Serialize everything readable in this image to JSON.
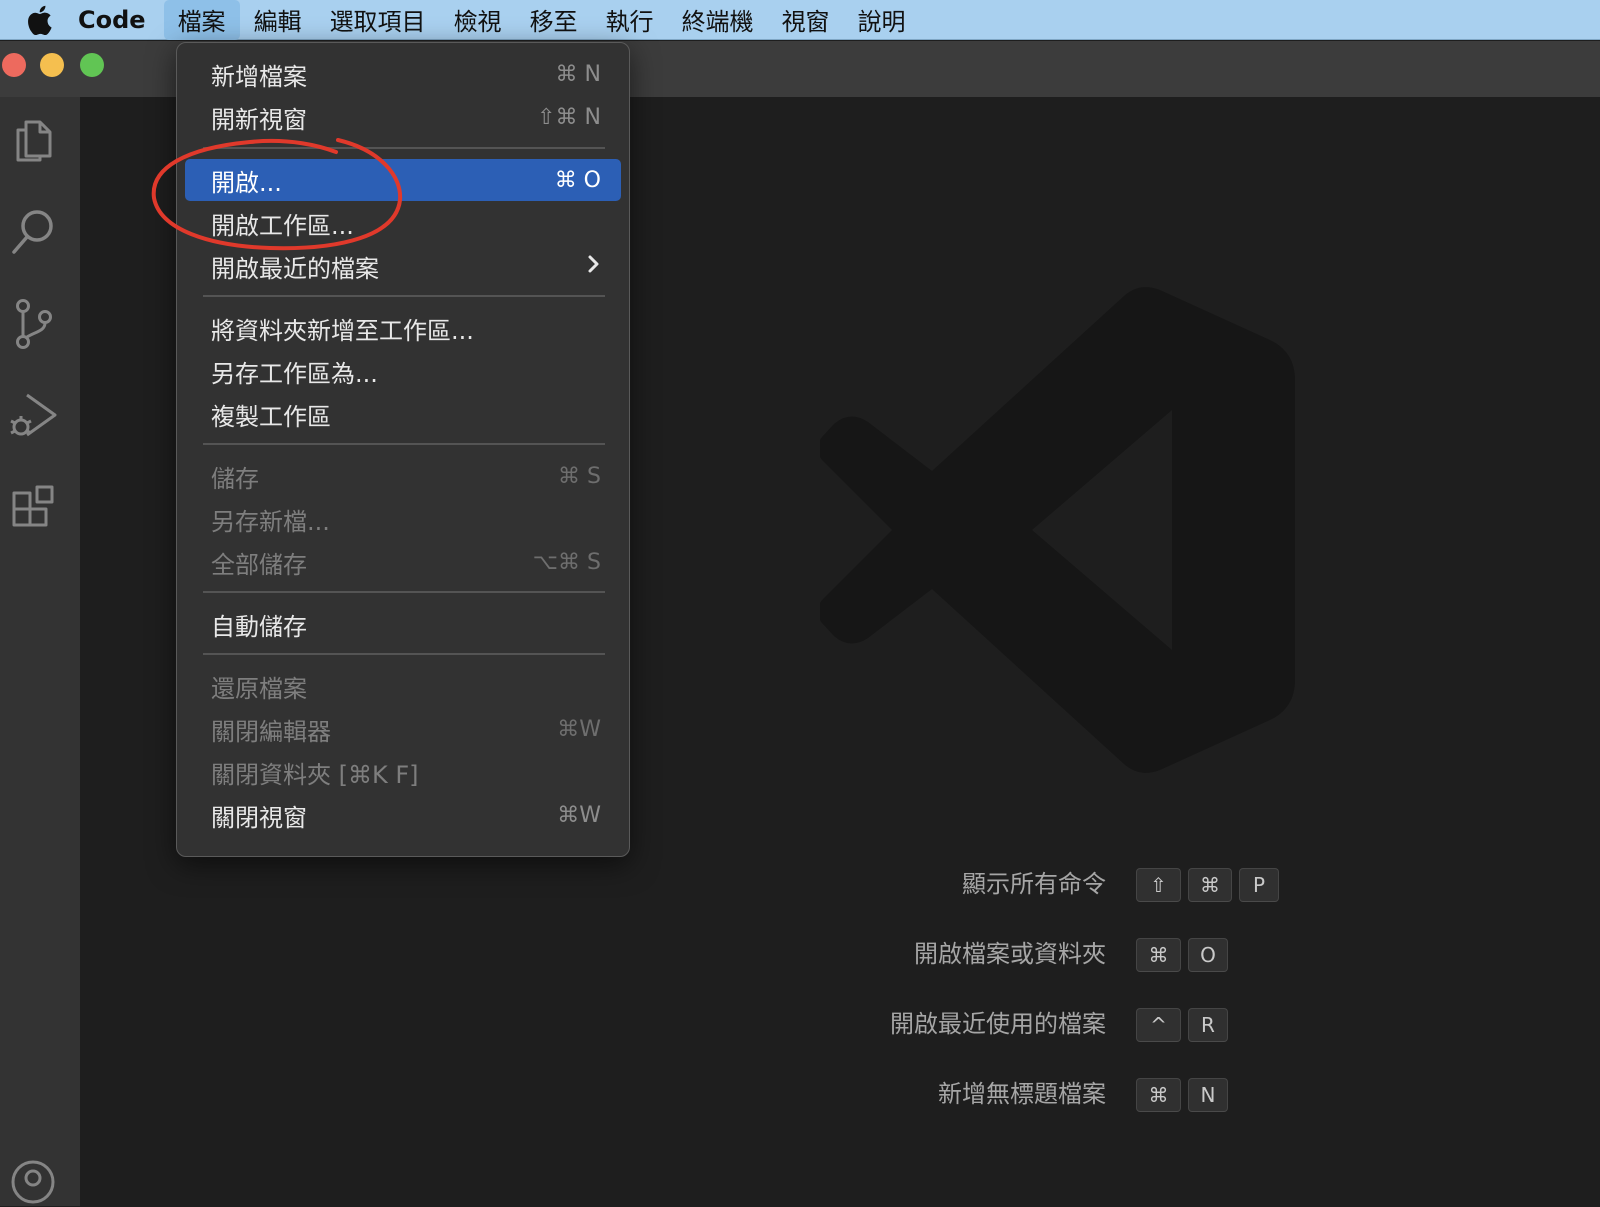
{
  "menubar": {
    "app_name": "Code",
    "items": [
      "檔案",
      "編輯",
      "選取項目",
      "檢視",
      "移至",
      "執行",
      "終端機",
      "視窗",
      "說明"
    ],
    "active_item": "檔案"
  },
  "window": {
    "traffic_lights": {
      "close": "#ed6a5e",
      "minimize": "#f5bf4f",
      "zoom": "#61c554"
    }
  },
  "activity_bar": {
    "icons": [
      "files-icon",
      "search-icon",
      "source-control-icon",
      "run-debug-icon",
      "extensions-icon",
      "account-icon"
    ]
  },
  "file_menu": {
    "items": [
      {
        "label": "新增檔案",
        "shortcut": "⌘ N"
      },
      {
        "label": "開新視窗",
        "shortcut": "⇧⌘ N"
      },
      {
        "label": "開啟...",
        "shortcut": "⌘ O",
        "highlighted": true
      },
      {
        "label": "開啟工作區..."
      },
      {
        "label": "開啟最近的檔案",
        "submenu": true
      },
      {
        "label": "將資料夾新增至工作區..."
      },
      {
        "label": "另存工作區為..."
      },
      {
        "label": "複製工作區"
      },
      {
        "label": "儲存",
        "shortcut": "⌘ S",
        "disabled": true
      },
      {
        "label": "另存新檔...",
        "disabled": true
      },
      {
        "label": "全部儲存",
        "shortcut": "⌥⌘ S",
        "disabled": true
      },
      {
        "label": "自動儲存"
      },
      {
        "label": "還原檔案",
        "disabled": true
      },
      {
        "label": "關閉編輯器",
        "shortcut": "⌘W",
        "disabled": true
      },
      {
        "label": "關閉資料夾 [⌘K F]",
        "disabled": true
      },
      {
        "label": "關閉視窗",
        "shortcut": "⌘W"
      }
    ]
  },
  "welcome_hints": [
    {
      "label": "顯示所有命令",
      "keys": [
        "⇧",
        "⌘",
        "P"
      ]
    },
    {
      "label": "開啟檔案或資料夾",
      "keys": [
        "⌘",
        "O"
      ]
    },
    {
      "label": "開啟最近使用的檔案",
      "keys": [
        "^",
        "R"
      ]
    },
    {
      "label": "新增無標題檔案",
      "keys": [
        "⌘",
        "N"
      ]
    }
  ],
  "colors": {
    "menubar": "#a9d0ef",
    "highlight": "#2c5fb5",
    "annotation": "#e0392b",
    "editor_bg": "#1e1e1e"
  }
}
